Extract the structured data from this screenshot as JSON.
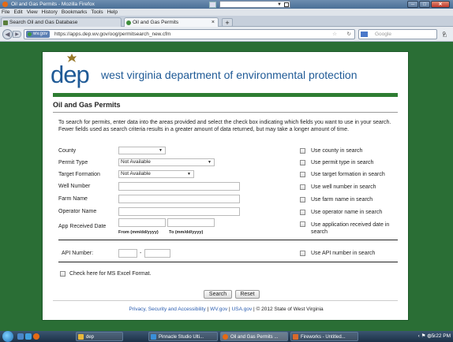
{
  "window": {
    "title": "Oil and Gas Permits - Mozilla Firefox"
  },
  "menu": [
    "File",
    "Edit",
    "View",
    "History",
    "Bookmarks",
    "Tools",
    "Help"
  ],
  "tabs": [
    {
      "label": "Search Oil and Gas Database"
    },
    {
      "label": "Oil and Gas Permits"
    }
  ],
  "nav": {
    "site_badge": "wv.gov",
    "url": "https://apps.dep.wv.gov/oog/permitsearch_new.cfm",
    "search_placeholder": "Google"
  },
  "header": {
    "logo_text": "dep",
    "org_name": "west virginia department of environmental protection"
  },
  "page": {
    "title": "Oil and Gas Permits",
    "intro": "To search for permits, enter data into the areas provided and select the check box indicating which fields you want to use in your search. Fewer fields used as search criteria results in a greater amount of data returned, but may take a longer amount of time."
  },
  "form": {
    "county": {
      "label": "County",
      "value": "",
      "check": "Use county in search"
    },
    "permit_type": {
      "label": "Permit Type",
      "value": "Not Available",
      "check": "Use permit type in search"
    },
    "target_formation": {
      "label": "Target Formation",
      "value": "Not Available",
      "check": "Use target formation in search"
    },
    "well_number": {
      "label": "Well Number",
      "check": "Use well number in search"
    },
    "farm_name": {
      "label": "Farm Name",
      "check": "Use farm name in search"
    },
    "operator_name": {
      "label": "Operator Name",
      "check": "Use operator name in search"
    },
    "app_received": {
      "label": "App Received Date",
      "from_label": "From (mm/dd/yyyy)",
      "to_label": "To (mm/dd/yyyy)",
      "check": "Use application received date in search"
    },
    "api_number": {
      "label": "API Number:",
      "separator": "-",
      "check": "Use API number in search"
    },
    "excel": {
      "label": "Check here for MS Excel Format."
    },
    "search_button": "Search",
    "reset_button": "Reset"
  },
  "footer": {
    "privacy": "Privacy, Security and Accessibility",
    "wvgov": "WV.gov",
    "usagov": "USA.gov",
    "copyright": "© 2012 State of West Virginia",
    "sep": "|"
  },
  "taskbar": {
    "items": [
      "dep",
      "Pinnacle Studio Ulti...",
      "Oil and Gas Permits ...",
      "Fireworks - Untitled..."
    ],
    "clock": "5:22 PM"
  }
}
